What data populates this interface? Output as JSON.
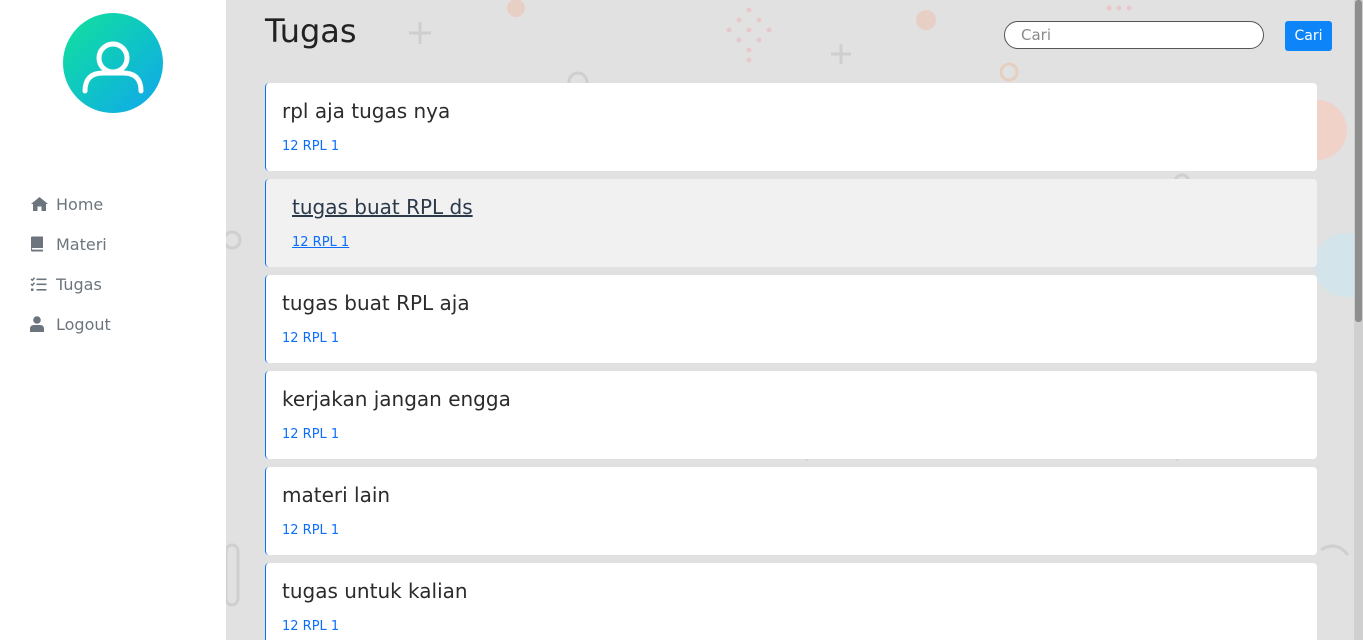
{
  "sidebar": {
    "items": [
      {
        "label": "Home",
        "icon": "home-icon"
      },
      {
        "label": "Materi",
        "icon": "book-icon"
      },
      {
        "label": "Tugas",
        "icon": "list-check-icon"
      },
      {
        "label": "Logout",
        "icon": "user-icon"
      }
    ]
  },
  "header": {
    "title": "Tugas",
    "search_placeholder": "Cari",
    "search_value": "",
    "search_button": "Cari"
  },
  "tasks": [
    {
      "title": "rpl aja tugas nya",
      "class": "12 RPL 1"
    },
    {
      "title": "tugas buat RPL ds",
      "class": "12 RPL 1"
    },
    {
      "title": "tugas buat RPL aja",
      "class": "12 RPL 1"
    },
    {
      "title": "kerjakan jangan engga",
      "class": "12 RPL 1"
    },
    {
      "title": "materi lain",
      "class": "12 RPL 1"
    },
    {
      "title": "tugas untuk kalian",
      "class": "12 RPL 1"
    }
  ],
  "colors": {
    "accent": "#0d84f7",
    "link": "#0d6efd",
    "sidebar_text": "#6c757d",
    "avatar_gradient": [
      "#13e29a",
      "#10a6ee"
    ]
  }
}
